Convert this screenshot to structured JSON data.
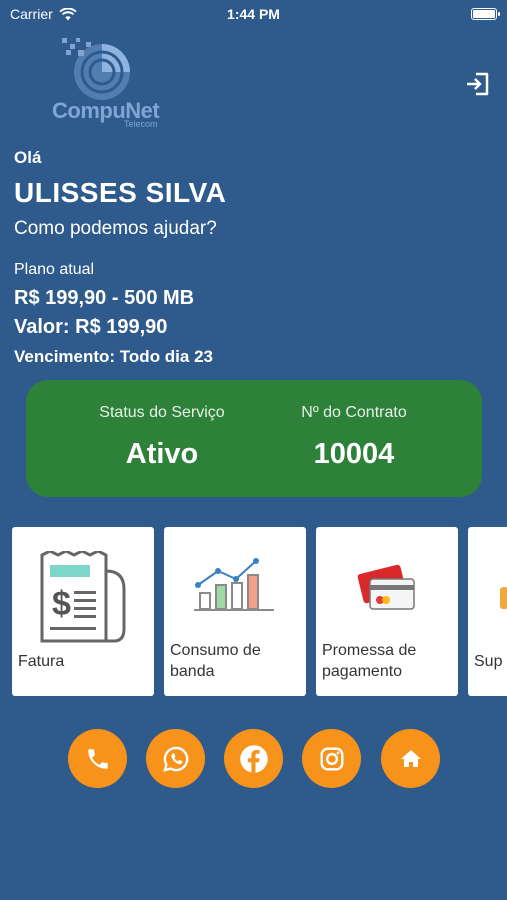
{
  "status_bar": {
    "carrier": "Carrier",
    "time": "1:44 PM"
  },
  "logo": {
    "text": "CompuNet",
    "sub": "Telecom"
  },
  "greeting": "Olá",
  "user_name": "ULISSES SILVA",
  "help_text": "Como podemos ajudar?",
  "plan": {
    "label": "Plano atual",
    "name": "R$ 199,90 - 500 MB",
    "value": "Valor: R$ 199,90",
    "due": "Vencimento: Todo dia 23"
  },
  "service": {
    "status_label": "Status do Serviço",
    "status_value": "Ativo",
    "contract_label": "Nº do Contrato",
    "contract_value": "10004"
  },
  "tiles": [
    {
      "label": "Fatura",
      "icon": "invoice-icon"
    },
    {
      "label": "Consumo de banda",
      "icon": "bandwidth-chart-icon"
    },
    {
      "label": "Promessa de pagamento",
      "icon": "credit-card-icon"
    },
    {
      "label": "Sup",
      "icon": "support-icon"
    }
  ],
  "actions": [
    {
      "name": "phone",
      "icon": "phone-icon"
    },
    {
      "name": "whatsapp",
      "icon": "whatsapp-icon"
    },
    {
      "name": "facebook",
      "icon": "facebook-icon"
    },
    {
      "name": "instagram",
      "icon": "instagram-icon"
    },
    {
      "name": "home",
      "icon": "home-icon"
    }
  ],
  "colors": {
    "background": "#2e5a8c",
    "status_card": "#2e8138",
    "action_button": "#f7931a",
    "tile_background": "#ffffff"
  }
}
